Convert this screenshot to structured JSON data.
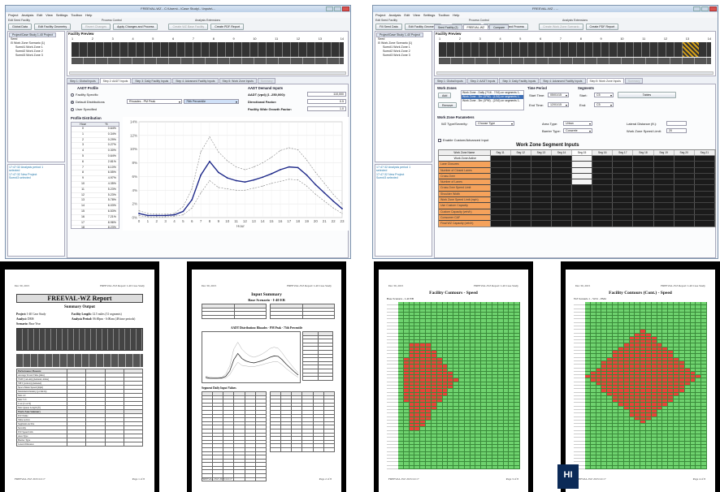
{
  "app1": {
    "title": "FREEVAL-WZ - C:\\Users\\...\\Case Study\\...\\Inputs\\...",
    "menu": [
      "Project",
      "Analysis",
      "Edit",
      "View",
      "Settings",
      "Toolbox",
      "Help"
    ],
    "groups": {
      "edit": "Edit Seed Facility",
      "process": "Process Control",
      "analysis": "Analysis Extensions"
    },
    "toolbar": [
      "Global Data",
      "Edit Facility Geometry",
      "Revert Changes",
      "Apply Changes and Process",
      "Create WZ Base Facility",
      "Create PDF Report"
    ],
    "tree": {
      "tab": "Project/Case Study 1-40 Project",
      "items": [
        "Seed",
        "Work Zone Scenario (1)",
        "Scen#1 Work Zone 1",
        "Scen#2 Work Zone 2",
        "Scen#3 Work Zone 3"
      ]
    },
    "log": [
      "17:47:32 Analysis period 1",
      "selected",
      "17:47:32 New Project",
      "Scen#3 selected"
    ],
    "preview_title": "Facility Preview",
    "segments": [
      "1",
      "2",
      "3",
      "4",
      "5",
      "6",
      "7",
      "8",
      "9",
      "10",
      "11",
      "12",
      "13",
      "14"
    ],
    "steps": [
      "Step 1: Global Inputs",
      "Step 2: AADT Inputs",
      "Step 3: Daily Facility Inputs",
      "Step 4: Advanced Facility Inputs",
      "Step 5: Work Zone Inputs",
      "Summary"
    ],
    "aadt_profile": {
      "title": "AADT Profile",
      "opt1": "Facility Specific",
      "opt2": "Default Distributions",
      "opt3": "User Specified",
      "dist": "Rhoades - PM Peak",
      "pct": "75th Percentile"
    },
    "aadt_demand": {
      "title": "AADT Demand Inputs",
      "l1": "AADT (vpd) (1 -250,000):",
      "v1": "110,000",
      "l2": "Directional Factor:",
      "v2": "0.5",
      "l3": "Facility Wide Growth Factor:",
      "v3": "1.0"
    },
    "profile": {
      "title": "Profile Distribution",
      "hdr": [
        "Hour",
        "%"
      ],
      "hours": [
        "0",
        "1",
        "2",
        "3",
        "4",
        "5",
        "6",
        "7",
        "8",
        "9",
        "10",
        "11",
        "12",
        "13",
        "14",
        "15",
        "16",
        "17",
        "18",
        "19"
      ],
      "pcts": [
        "0.64%",
        "0.34%",
        "0.29%",
        "0.27%",
        "0.30%",
        "0.64%",
        "2.81%",
        "6.10%",
        "6.55%",
        "4.97%",
        "4.35%",
        "5.23%",
        "5.23%",
        "5.78%",
        "6.03%",
        "6.53%",
        "7.21%",
        "8.96%",
        "8.23%",
        "6.96%"
      ]
    },
    "chart_data": {
      "type": "line",
      "x": [
        0,
        1,
        2,
        3,
        4,
        5,
        6,
        7,
        8,
        9,
        10,
        11,
        12,
        13,
        14,
        15,
        16,
        17,
        18,
        19,
        20,
        21,
        22,
        23
      ],
      "series": [
        {
          "values": [
            0.6,
            0.3,
            0.3,
            0.3,
            0.4,
            0.9,
            2.6,
            6.2,
            8.2,
            6.6,
            5.8,
            5.4,
            5.2,
            5.5,
            5.9,
            6.4,
            7.0,
            7.4,
            7.3,
            6.2,
            4.8,
            3.6,
            2.4,
            1.3
          ]
        },
        {
          "values": [
            1.0,
            0.6,
            0.5,
            0.5,
            0.6,
            1.6,
            4.2,
            9.6,
            11.8,
            9.6,
            8.3,
            7.4,
            7.0,
            7.4,
            8.0,
            8.8,
            9.8,
            10.2,
            9.9,
            8.4,
            6.6,
            5.0,
            3.4,
            2.0
          ]
        },
        {
          "values": [
            0.3,
            0.1,
            0.1,
            0.1,
            0.2,
            0.4,
            1.4,
            3.6,
            5.4,
            4.4,
            4.2,
            4.0,
            4.0,
            4.3,
            4.6,
            5.0,
            5.3,
            5.6,
            5.5,
            4.6,
            3.4,
            2.4,
            1.4,
            0.6
          ]
        }
      ],
      "ylabels": [
        "0%",
        "2%",
        "4%",
        "6%",
        "8%",
        "10%",
        "12%",
        "14%"
      ],
      "xlabel": "Hour",
      "ylim": [
        0,
        14
      ]
    }
  },
  "app2": {
    "title": "FREEVAL-WZ - ...",
    "menu": [
      "Project",
      "Analysis",
      "Edit",
      "View",
      "Settings",
      "Toolbox",
      "Help"
    ],
    "toolbar": [
      "Fill Seed Data",
      "Edit Facility Geometry",
      "Revert Changes",
      "Apply Changes and Process",
      "Create Work Zone Scenario",
      "Create PDF Report"
    ],
    "tree": {
      "tab": "Project/Case Study 1-40 Project",
      "items": [
        "Seed",
        "Work Zone Scenario (1)",
        "Scen#1 Work Zone 1",
        "Scen#2 Work Zone 2",
        "Scen#3 Work Zone 3"
      ]
    },
    "log": [
      "17:47:32 Analysis period 1",
      "selected",
      "17:47:32 New Project",
      "Scen#3 selected"
    ],
    "tabs": [
      "Seed Facility (2)",
      "FREEVAL-WZ",
      "Compare"
    ],
    "steps": [
      "Step 1: Global Inputs",
      "Step 2: AADT Inputs",
      "Step 3: Daily Facility Inputs",
      "Step 4: Advanced Facility Inputs",
      "Step 5: Work Zone Inputs",
      "Summary"
    ],
    "wz": {
      "title": "Work Zones",
      "add": "Add",
      "remove": "Remove",
      "list": [
        "Work Zone - Daily (7/16 - 7/16) on segments 1-",
        "Work Zone - 3hr (1PM) - (1/16) on segments 1-",
        "Work Zone - 3hr (1PM) - (2/16) on segments 1-"
      ]
    },
    "tp": {
      "title": "Time Period",
      "start": "Start Time:",
      "end": "End Time:",
      "sv": "05/01/15",
      "ev": "12/01/15"
    },
    "seg": {
      "title": "Segments",
      "start": "Start:",
      "end": "End:",
      "sv": "C5",
      "ev": "C5",
      "tables": "Tables"
    },
    "params": {
      "title": "Work Zone Parameters",
      "l1": "WZ Type/Severity:",
      "v1": "Choose Type",
      "l2": "Area Type:",
      "v2": "Urban",
      "l3": "Barrier Type:",
      "v3": "Concrete",
      "l4": "Lateral Distance (ft.):",
      "l5": "Work Zone Speed Limit:",
      "v5": "20"
    },
    "custom": "Enable Custom/Advanced Input",
    "seginputs": {
      "title": "Work Zone Segment Inputs",
      "hdr": "Work Zone Name",
      "rows": [
        "Work Zone Active",
        "Lane Closures",
        "Number of Closed Lanes",
        "Cross-Over",
        "Number of Lanes",
        "Cross-Over Speed Limit",
        "Shoulder Width",
        "Work Zone Speed Limit (mph)",
        "Use Custom Capacity",
        "Custom Capacity (veh/h)",
        "Consumer CAF",
        "Final WZ Capacity (veh/h)"
      ],
      "cols": [
        "Seg 11",
        "Seg 12",
        "Seg 13",
        "Seg 14",
        "Seg 15",
        "Seg 16",
        "Seg 17",
        "Seg 18",
        "Seg 19",
        "Seg 20",
        "Seg 21"
      ]
    }
  },
  "pages": [
    {
      "header_l": "Dec 30, 2015",
      "header_r": "FREEVAL-WZ Report: I-40 Case Study",
      "title": "FREEVAL-WZ Report",
      "sub": "Summary Output",
      "project_l": "Project:",
      "project": "I-40 Case Study",
      "analyst_l": "Analyst:",
      "analyst": "DMS",
      "scenario_l": "Scenario:",
      "scenario": "Base Year",
      "facility_l": "Facility Length:",
      "facility": "12.5 miles (31 segments)",
      "period_l": "Analysis Period:",
      "period": "06:00pm - 6:00am (48 time periods)",
      "footer_l": "FREEVAL-WZ 2015/12/17",
      "footer_r": "Page 1 of 8",
      "rows": [
        "Performance Measure",
        "Average Travel Time (min)",
        "VMT (veh-mi) (demand, miles)",
        "VHT (veh-hr) (demand)",
        "Space Mean Speed (mph)",
        "Maximum Density (pc/mi/ln)",
        "Max d/c",
        "Max V/C",
        "Cost (Cost $)",
        "Max Queue Length (ft)",
        "Work Zone Summary",
        "WZ Name",
        "Time Active",
        "Segments Active",
        "Severity",
        "WZ Speed Lim",
        "Area Type",
        "Barrier Type",
        "Lateral Distance"
      ]
    },
    {
      "header_l": "Dec 30, 2015",
      "header_r": "FREEVAL-WZ Report: I-40 Case Study",
      "title": "Input Summary",
      "sub": "Base Scenario - I-40 EB",
      "chart_title": "AADT Distribution: Rhoades - PM Peak - 75th Percentile",
      "table_title": "Segment Daily Input Values",
      "footer_l": "FREEVAL-WZ 2015/12/17",
      "footer_r": "Page 2 of 8"
    },
    {
      "header_l": "Dec 30, 2015",
      "header_r": "FREEVAL-WZ Report: I-40 Case Study",
      "title": "Facility Contours - Speed",
      "sub": "Base Scenario - I-40 EB",
      "footer_l": "FREEVAL-WZ 2015/12/17",
      "footer_r": "Page 3 of 8"
    },
    {
      "header_l": "Dec 30, 2015",
      "header_r": "FREEVAL-WZ Report: I-40 Case Study",
      "title": "Facility Contours (Cont.) - Speed",
      "sub": "WZ Scenario 1 - WZ1 - PM4",
      "footer_l": "FREEVAL-WZ 2015/12/17",
      "footer_r": "Page 4 of 8"
    }
  ],
  "banner": "HI",
  "colors": {
    "accent_blue": "#1f2a8a",
    "wz_orange": "#f5a25b",
    "contour_red": "#e8443a",
    "contour_green": "#6fd36f"
  }
}
